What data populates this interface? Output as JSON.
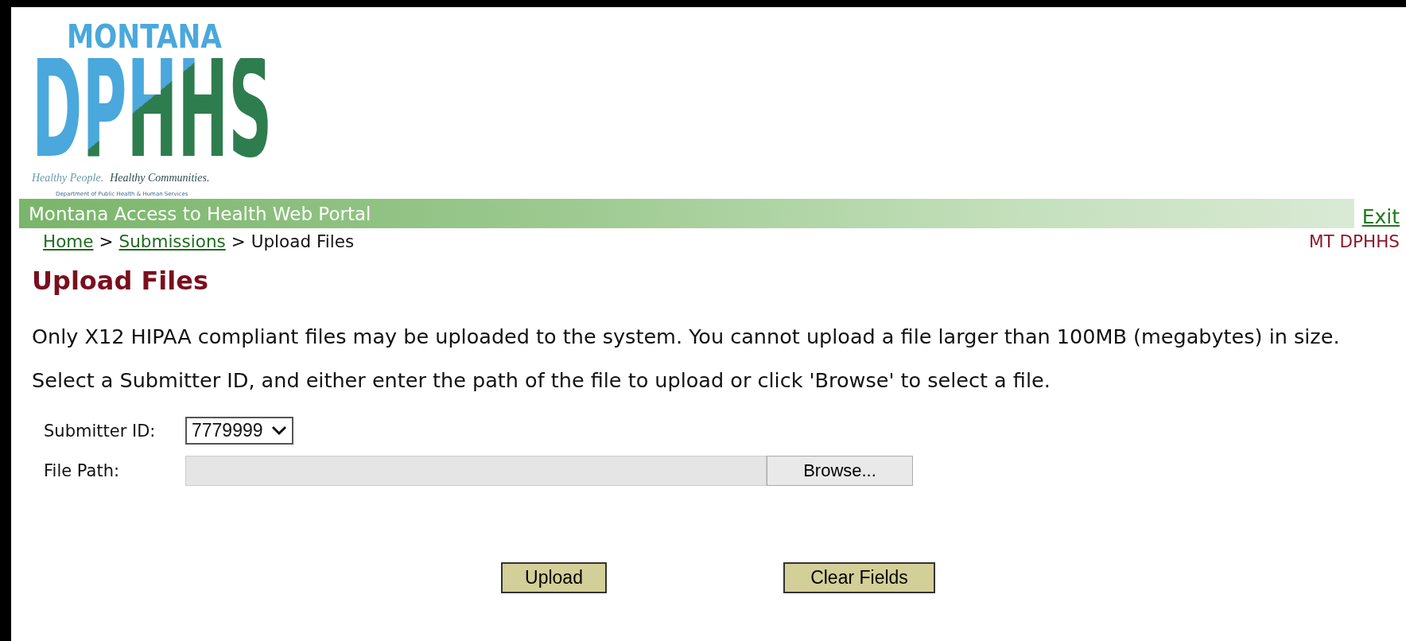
{
  "logo": {
    "title": "MONTANA",
    "acronym": "DPHHS",
    "tagline_1": "Healthy People.",
    "tagline_2": "Healthy Communities.",
    "department": "Department of Public Health & Human Services"
  },
  "portal_bar": {
    "title": "Montana Access to Health Web Portal"
  },
  "exit_link": "Exit",
  "breadcrumb": {
    "separator": ">",
    "items": [
      {
        "label": "Home",
        "kind": "link"
      },
      {
        "label": "Submissions",
        "kind": "link"
      },
      {
        "label": "Upload Files",
        "kind": "current"
      }
    ]
  },
  "agency": "MT DPHHS",
  "heading": "Upload Files",
  "paragraphs": [
    "Only X12 HIPAA compliant files may be uploaded to the system. You cannot upload a file larger than 100MB (megabytes) in size.",
    "Select a Submitter ID, and either enter the path of the file to upload or click 'Browse' to select a file."
  ],
  "form": {
    "submitter_id": {
      "label": "Submitter ID:",
      "value": "7779999"
    },
    "file_path": {
      "label": "File Path:",
      "browse": "Browse..."
    }
  },
  "buttons": [
    "Upload",
    "Clear Fields"
  ]
}
